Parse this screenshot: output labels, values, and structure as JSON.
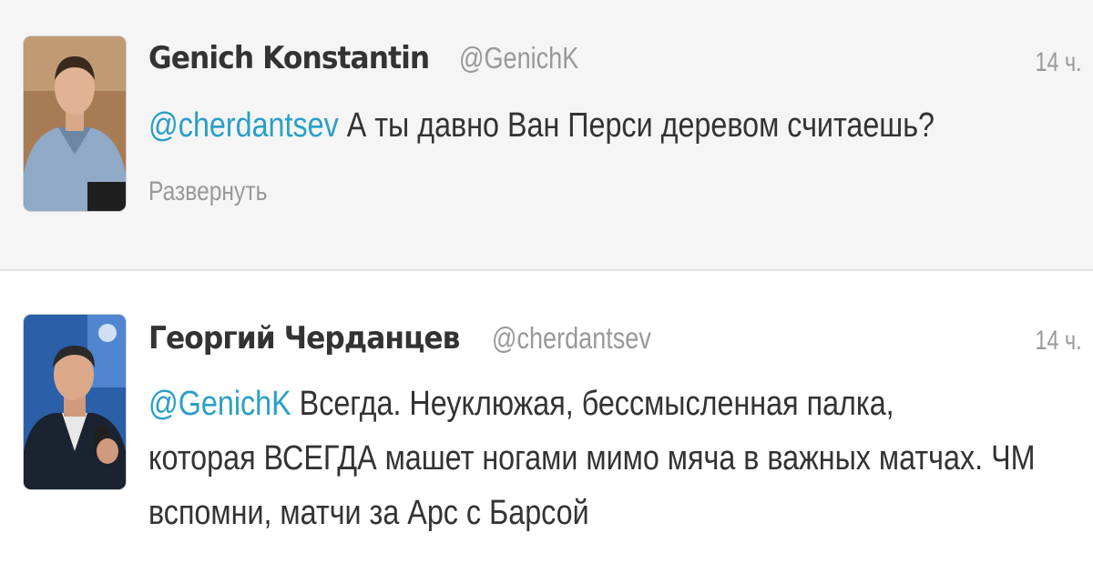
{
  "tweets": [
    {
      "name": "Genich Konstantin",
      "handle": "@GenichK",
      "time": "14 ч.",
      "mention": "@cherdantsev",
      "text": " А ты давно Ван Перси деревом считаешь?",
      "expand_label": "Развернуть",
      "avatar": "profile-photo"
    },
    {
      "name": "Георгий Черданцев",
      "handle": "@cherdantsev",
      "time": "14 ч.",
      "mention": "@GenichK",
      "text_lines": [
        " Всегда. Неуклюжая, бессмысленная палка,",
        "которая ВСЕГДА машет ногами мимо мяча в важных матчах. ЧМ",
        "вспомни, матчи за Арс с Барсой"
      ],
      "avatar": "profile-photo"
    }
  ],
  "colors": {
    "link": "#2a9fc6",
    "name": "#333333",
    "muted": "#999999",
    "tweet1_bg": "#f5f5f5",
    "tweet2_bg": "#ffffff"
  }
}
